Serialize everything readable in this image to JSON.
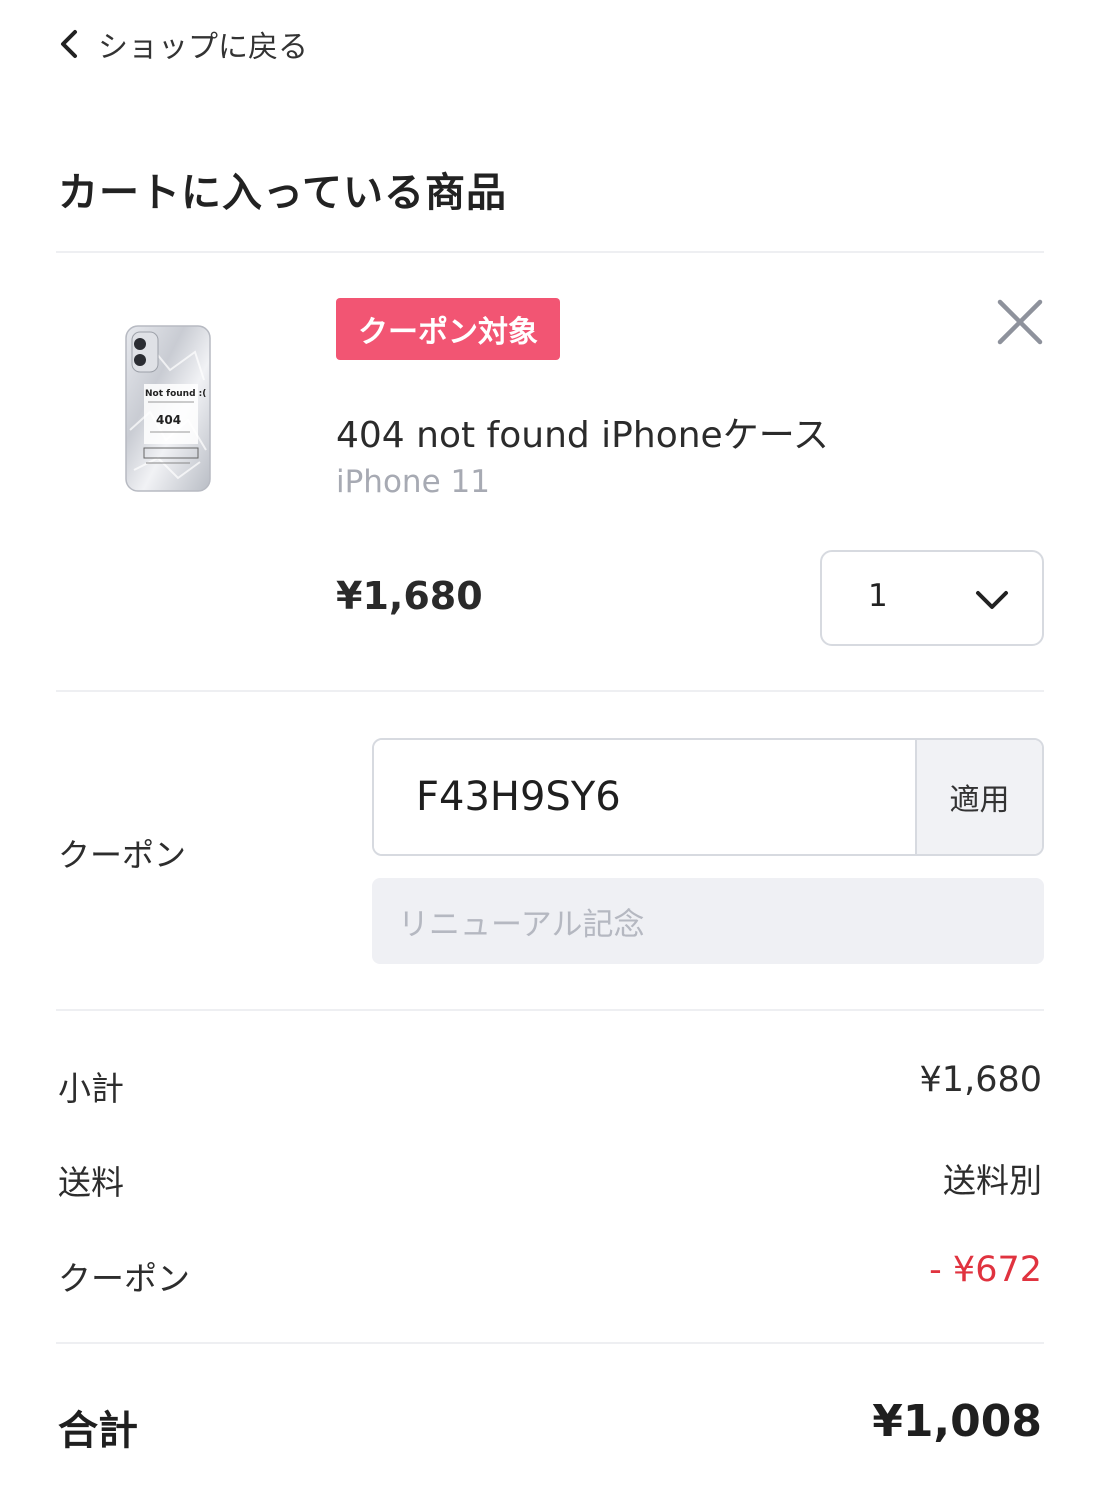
{
  "nav": {
    "back_label": "ショップに戻る"
  },
  "cart": {
    "title": "カートに入っている商品",
    "item": {
      "badge": "クーポン対象",
      "name": "404 not found iPhoneケース",
      "variant": "iPhone 11",
      "price": "¥1,680",
      "quantity": "1",
      "case_print": {
        "heading": "Not found :(",
        "code": "404"
      }
    }
  },
  "coupon": {
    "label": "クーポン",
    "code": "F43H9SY6",
    "apply_label": "適用",
    "description": "リニューアル記念"
  },
  "summary": {
    "subtotal_label": "小計",
    "subtotal_value": "¥1,680",
    "shipping_label": "送料",
    "shipping_value": "送料別",
    "coupon_label": "クーポン",
    "coupon_value": "- ¥672",
    "total_label": "合計",
    "total_value": "¥1,008"
  },
  "colors": {
    "badge": "#f25573",
    "discount": "#e0333f",
    "muted": "#a7aab3"
  },
  "icons": [
    "chevron-left-icon",
    "close-icon",
    "chevron-down-icon"
  ]
}
